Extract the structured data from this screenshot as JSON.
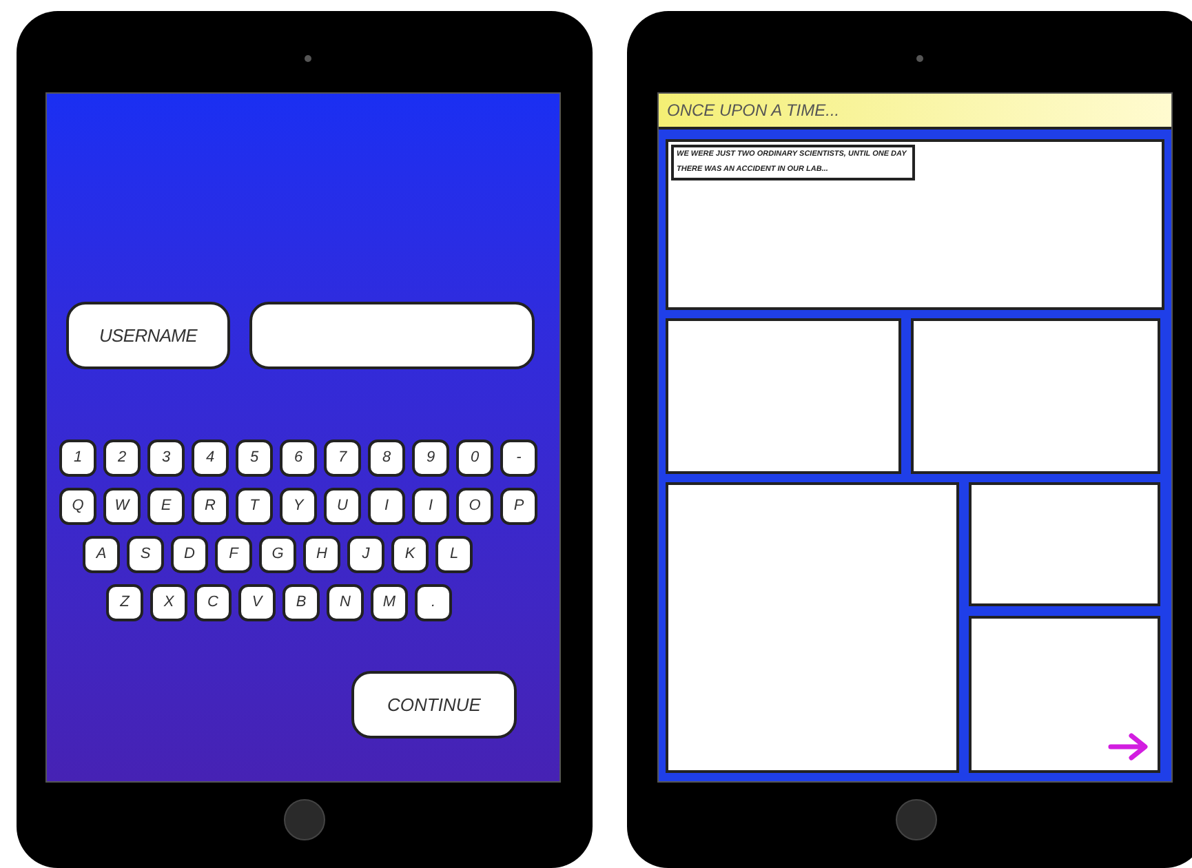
{
  "login_screen": {
    "username_label": "USERNAME",
    "keyboard_rows": [
      [
        "1",
        "2",
        "3",
        "4",
        "5",
        "6",
        "7",
        "8",
        "9",
        "0",
        "-"
      ],
      [
        "Q",
        "W",
        "E",
        "R",
        "T",
        "Y",
        "U",
        "I",
        "I",
        "O",
        "P"
      ],
      [
        "A",
        "S",
        "D",
        "F",
        "G",
        "H",
        "J",
        "K",
        "L"
      ],
      [
        "Z",
        "X",
        "C",
        "V",
        "B",
        "N",
        "M",
        "."
      ]
    ],
    "continue_button": "CONTINUE"
  },
  "comic_screen": {
    "title": "ONCE UPON A TIME...",
    "caption": "WE WERE JUST TWO ORDINARY SCIENTISTS, UNTIL ONE DAY THERE WAS AN ACCIDENT IN OUR LAB..."
  }
}
